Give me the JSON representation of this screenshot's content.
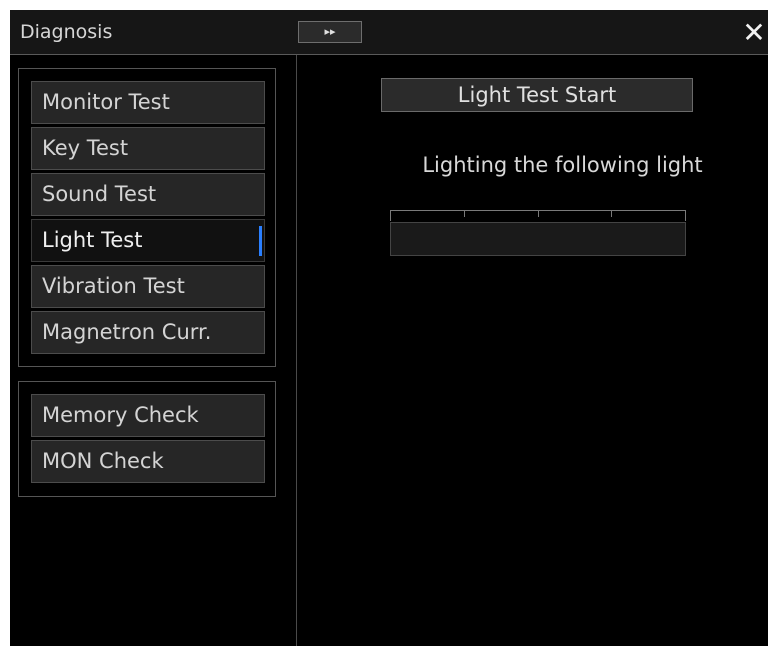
{
  "window": {
    "title": "Diagnosis",
    "expand_glyph": "▸▸",
    "close_glyph": "✕"
  },
  "menu": {
    "group1": [
      {
        "label": "Monitor Test",
        "selected": false
      },
      {
        "label": "Key Test",
        "selected": false
      },
      {
        "label": "Sound Test",
        "selected": false
      },
      {
        "label": "Light Test",
        "selected": true
      },
      {
        "label": "Vibration Test",
        "selected": false
      },
      {
        "label": "Magnetron Curr.",
        "selected": false
      }
    ],
    "group2": [
      {
        "label": "Memory Check",
        "selected": false
      },
      {
        "label": "MON Check",
        "selected": false
      }
    ]
  },
  "light_test": {
    "start_label": "Light Test Start",
    "status_text": "Lighting the following light"
  },
  "colors": {
    "accent": "#2a7fff",
    "background": "#000000"
  }
}
